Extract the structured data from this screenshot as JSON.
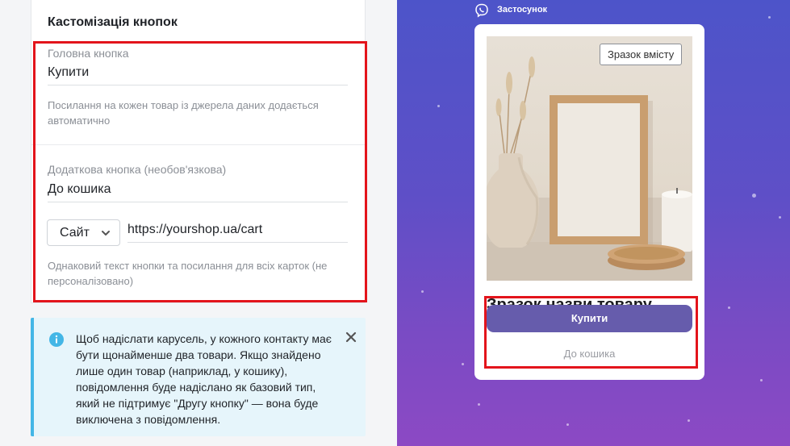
{
  "settings": {
    "title": "Кастомізація кнопок",
    "main_button": {
      "label": "Головна кнопка",
      "value": "Купити",
      "help": "Посилання на кожен товар із джерела даних додається автоматично"
    },
    "extra_button": {
      "label": "Додаткова кнопка (необов'язкова)",
      "value": "До кошика",
      "link_type": "Сайт",
      "url": "https://yourshop.ua/cart",
      "help": "Однаковий текст кнопки та посилання для всіх карток (не персоналізовано)"
    }
  },
  "notice": {
    "text": "Щоб надіслати карусель, у кожного контакту має бути щонайменше два товари. Якщо знайдено лише один товар (наприклад, у кошику), повідомлення буде надіслано як базовий тип, який не підтримує \"Другу кнопку\" — вона буде виключена з повідомлення."
  },
  "preview": {
    "app_name": "Застосунок",
    "sample_badge": "Зразок вмісту",
    "product_title": "Зразок назви товару",
    "buy_label": "Купити",
    "cart_label": "До кошика"
  },
  "colors": {
    "highlight": "#e3141b",
    "info_accent": "#43b6e6",
    "buy_button": "#665cac",
    "viber_gradient_top": "#4d54c9",
    "viber_gradient_bottom": "#8c49c4"
  },
  "icons": {
    "info": "info-icon",
    "close": "close-icon",
    "chevron": "chevron-down-icon",
    "app": "viber-icon"
  }
}
